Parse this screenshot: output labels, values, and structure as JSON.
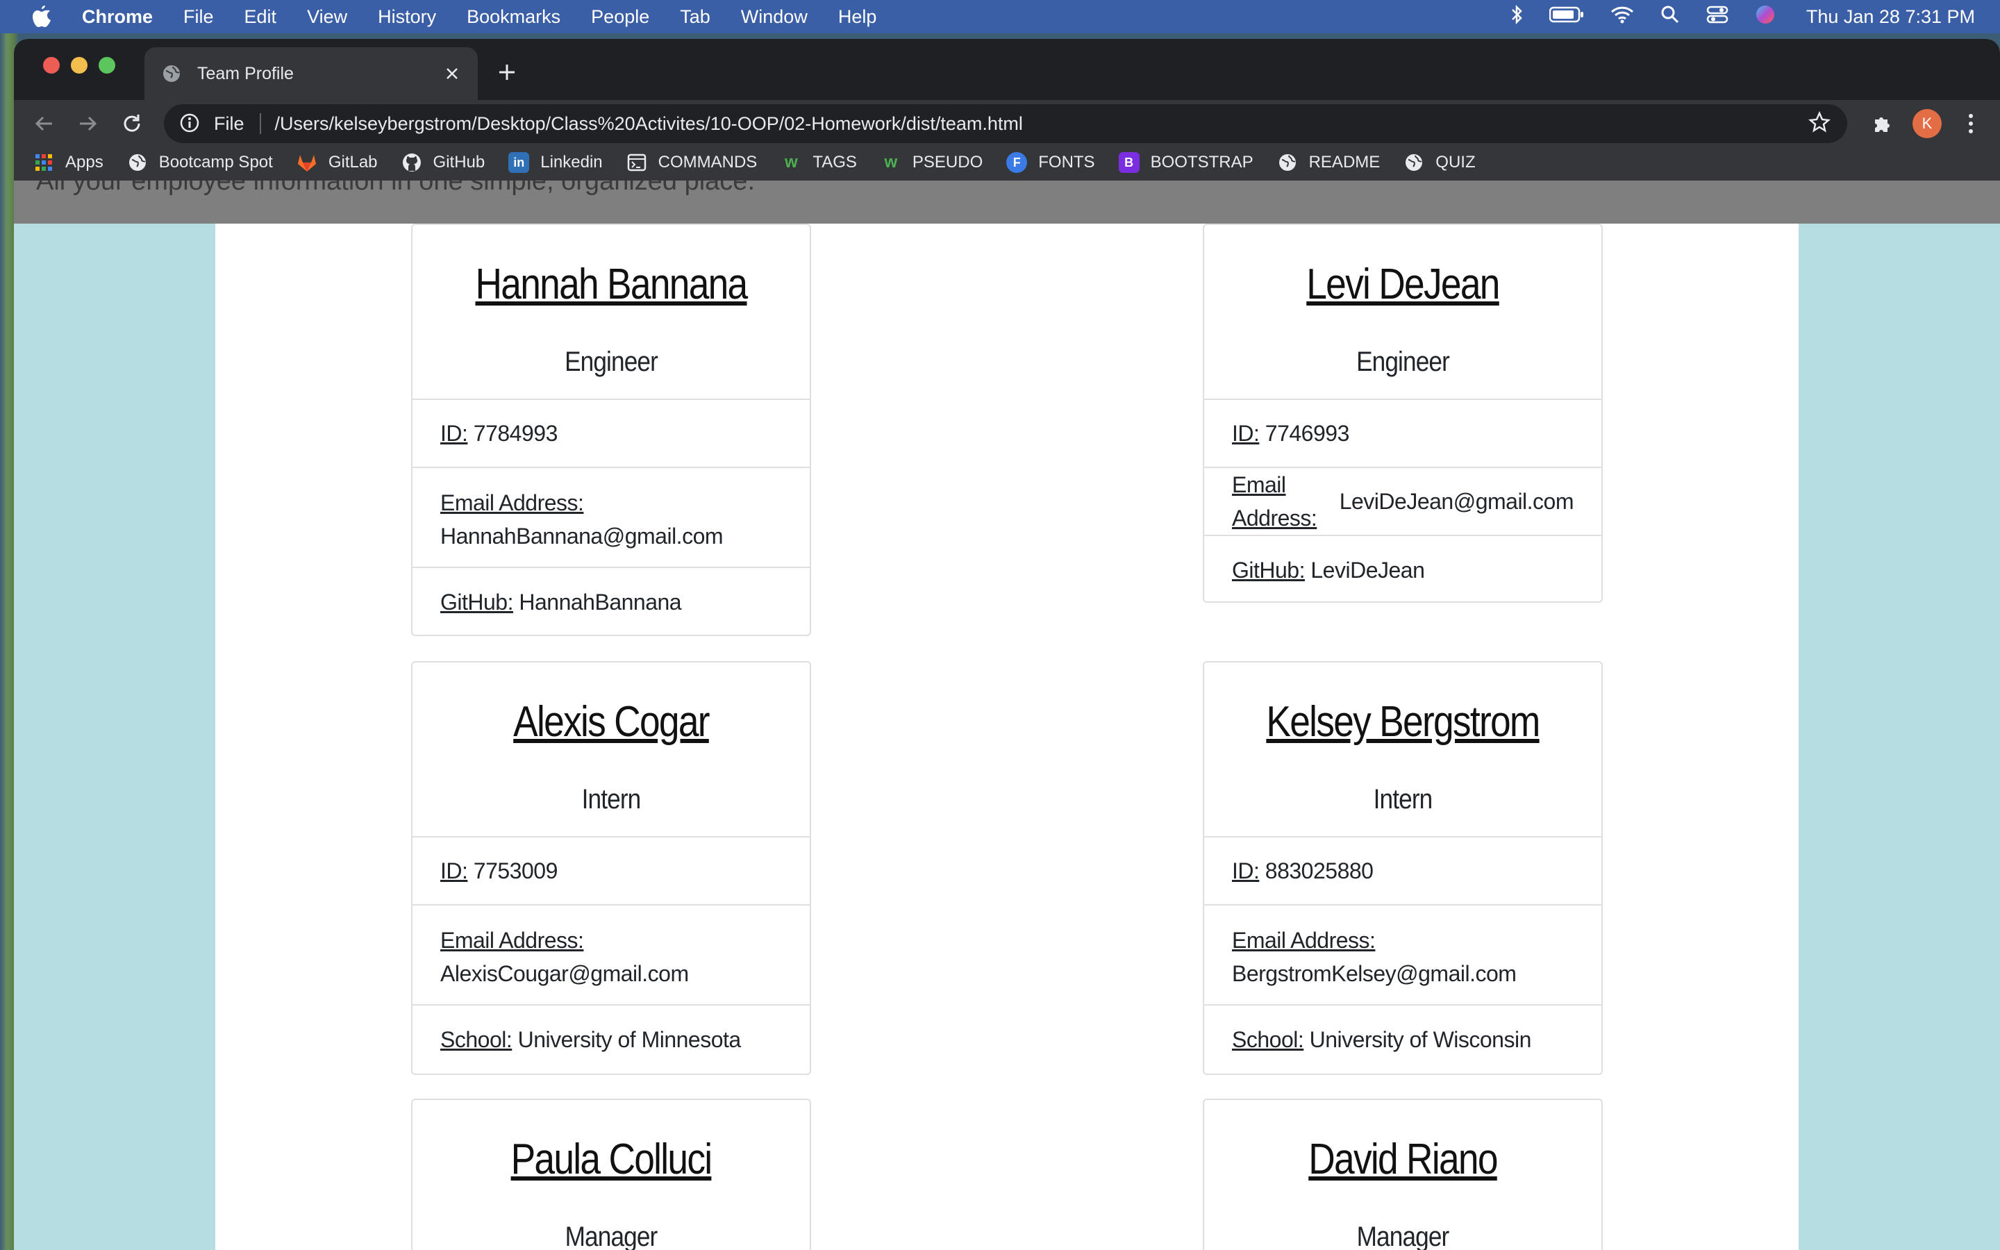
{
  "menubar": {
    "app": "Chrome",
    "items": [
      "File",
      "Edit",
      "View",
      "History",
      "Bookmarks",
      "People",
      "Tab",
      "Window",
      "Help"
    ],
    "clock": "Thu Jan 28  7:31 PM"
  },
  "browser": {
    "tab_title": "Team Profile",
    "url_scheme": "File",
    "url": "/Users/kelseybergstrom/Desktop/Class%20Activites/10-OOP/02-Homework/dist/team.html",
    "profile_initial": "K",
    "bookmarks": [
      "Apps",
      "Bootcamp Spot",
      "GitLab",
      "GitHub",
      "Linkedin",
      "COMMANDS",
      "TAGS",
      "PSEUDO",
      "FONTS",
      "BOOTSTRAP",
      "README",
      "QUIZ"
    ]
  },
  "page": {
    "lead_text": "All your employee information in one simple, organized place.",
    "labels": {
      "id": "ID:",
      "email": "Email Address:",
      "github": "GitHub:",
      "school": "School:"
    },
    "employees": [
      {
        "name": "Hannah Bannana",
        "role": "Engineer",
        "id": "7784993",
        "email": "HannahBannana@gmail.com",
        "github": "HannahBannana"
      },
      {
        "name": "Levi DeJean",
        "role": "Engineer",
        "id": "7746993",
        "email": "LeviDeJean@gmail.com",
        "github": "LeviDeJean"
      },
      {
        "name": "Alexis Cogar",
        "role": "Intern",
        "id": "7753009",
        "email": "AlexisCougar@gmail.com",
        "school": "University of Minnesota"
      },
      {
        "name": "Kelsey Bergstrom",
        "role": "Intern",
        "id": "883025880",
        "email": "BergstromKelsey@gmail.com",
        "school": "University of Wisconsin"
      },
      {
        "name": "Paula Colluci",
        "role": "Manager"
      },
      {
        "name": "David Riano",
        "role": "Manager"
      }
    ]
  }
}
